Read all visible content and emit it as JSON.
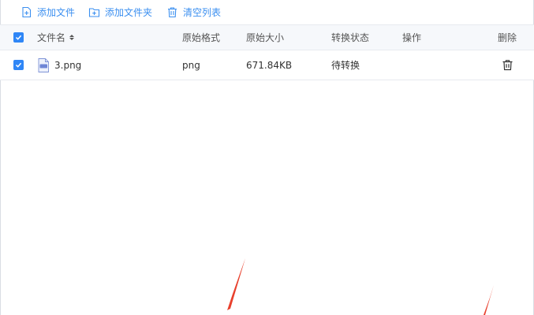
{
  "toolbar": {
    "add_file": "添加文件",
    "add_folder": "添加文件夹",
    "clear_list": "清空列表"
  },
  "table": {
    "headers": {
      "filename": "文件名",
      "format": "原始格式",
      "size": "原始大小",
      "status": "转换状态",
      "action": "操作",
      "delete": "删除"
    },
    "rows": [
      {
        "name": "3.png",
        "format": "png",
        "size": "671.84KB",
        "status": "待转换",
        "checked": true
      }
    ]
  },
  "colors": {
    "accent": "#3b8ff0",
    "checkbox": "#2f86f6",
    "arrow": "#e8402d",
    "header_bg": "#f6f8fb"
  },
  "icons": {
    "add_file": "file-plus-icon",
    "add_folder": "folder-plus-icon",
    "clear_list": "trash-icon",
    "row_delete": "trash-icon",
    "file_type": "image-file-icon"
  }
}
